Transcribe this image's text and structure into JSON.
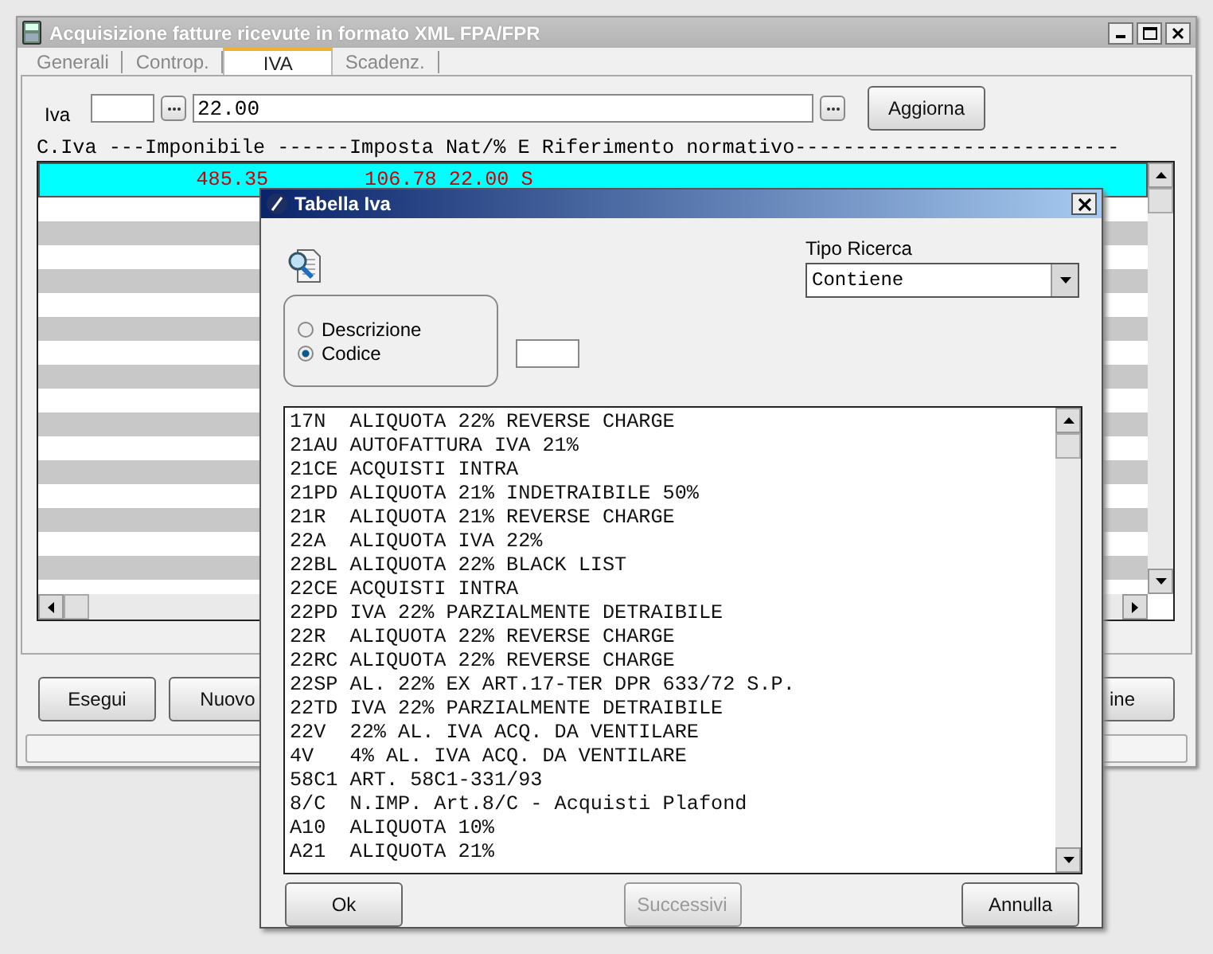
{
  "window": {
    "title": "Acquisizione fatture ricevute in formato XML FPA/FPR"
  },
  "tabs": [
    {
      "label": "Generali",
      "selected": false
    },
    {
      "label": "Controp.",
      "selected": false
    },
    {
      "label": "IVA",
      "selected": true
    },
    {
      "label": "Scadenz.",
      "selected": false
    }
  ],
  "iva": {
    "label": "Iva",
    "description": "22.00",
    "button": "Aggiorna"
  },
  "grid": {
    "header": "C.Iva ---Imponibile ------Imposta Nat/% E Riferimento normativo---------------------------",
    "rows": [
      {
        "imponibile": "485.35",
        "imposta": "106.78",
        "nat": "22.00",
        "e": "S",
        "selected": true
      }
    ]
  },
  "buttons": [
    {
      "label": "Esegui",
      "disabled": false
    },
    {
      "label": "Nuovo",
      "disabled": false
    },
    {
      "label": "ine",
      "disabled": false
    }
  ],
  "dialog": {
    "title": "Tabella Iva",
    "search_by": [
      {
        "label": "Descrizione",
        "selected": false
      },
      {
        "label": "Codice",
        "selected": true
      }
    ],
    "search_type": {
      "label": "Tipo Ricerca",
      "value": "Contiene"
    },
    "items": [
      {
        "code": "17N",
        "description": "ALIQUOTA 22% REVERSE CHARGE"
      },
      {
        "code": "21AU",
        "description": "AUTOFATTURA IVA 21%"
      },
      {
        "code": "21CE",
        "description": "ACQUISTI INTRA"
      },
      {
        "code": "21PD",
        "description": "ALIQUOTA 21% INDETRAIBILE 50%"
      },
      {
        "code": "21R",
        "description": "ALIQUOTA 21% REVERSE CHARGE"
      },
      {
        "code": "22A",
        "description": "ALIQUOTA IVA 22%"
      },
      {
        "code": "22BL",
        "description": "ALIQUOTA 22% BLACK LIST"
      },
      {
        "code": "22CE",
        "description": "ACQUISTI INTRA"
      },
      {
        "code": "22PD",
        "description": "IVA 22% PARZIALMENTE DETRAIBILE"
      },
      {
        "code": "22R",
        "description": "ALIQUOTA 22% REVERSE CHARGE"
      },
      {
        "code": "22RC",
        "description": "ALIQUOTA 22% REVERSE CHARGE"
      },
      {
        "code": "22SP",
        "description": "AL. 22% EX ART.17-TER DPR 633/72 S.P."
      },
      {
        "code": "22TD",
        "description": "IVA 22% PARZIALMENTE DETRAIBILE"
      },
      {
        "code": "22V",
        "description": "22% AL. IVA ACQ. DA VENTILARE"
      },
      {
        "code": "4V",
        "description": "4% AL. IVA ACQ. DA VENTILARE"
      },
      {
        "code": "58C1",
        "description": "ART. 58C1-331/93"
      },
      {
        "code": "8/C",
        "description": "N.IMP. Art.8/C - Acquisti Plafond"
      },
      {
        "code": "A10",
        "description": "ALIQUOTA 10%"
      },
      {
        "code": "A21",
        "description": "ALIQUOTA 21%"
      }
    ],
    "buttons": [
      {
        "label": "Ok",
        "disabled": false
      },
      {
        "label": "Successivi",
        "disabled": true
      },
      {
        "label": "Annulla",
        "disabled": false
      }
    ]
  }
}
